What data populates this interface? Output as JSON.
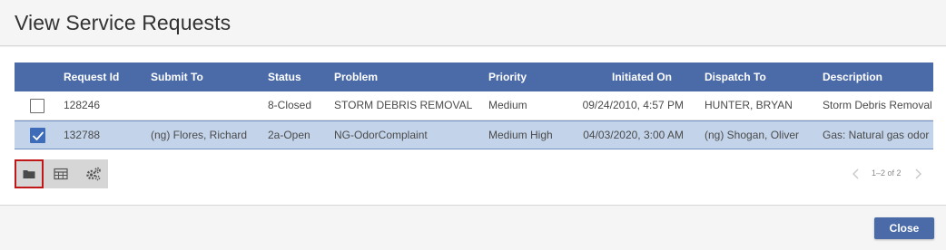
{
  "dialog": {
    "title": "View Service Requests"
  },
  "table": {
    "columns": {
      "request_id": "Request Id",
      "submit_to": "Submit To",
      "status": "Status",
      "problem": "Problem",
      "priority": "Priority",
      "initiated_on": "Initiated On",
      "dispatch_to": "Dispatch To",
      "description": "Description"
    },
    "rows": [
      {
        "checked": false,
        "request_id": "128246",
        "submit_to": "",
        "status": "8-Closed",
        "problem": "STORM DEBRIS REMOVAL",
        "priority": "Medium",
        "initiated_on": "09/24/2010, 4:57 PM",
        "dispatch_to": "HUNTER, BRYAN",
        "description": "Storm Debris Removal"
      },
      {
        "checked": true,
        "request_id": "132788",
        "submit_to": "(ng) Flores, Richard",
        "status": "2a-Open",
        "problem": "NG-OdorComplaint",
        "priority": "Medium High",
        "initiated_on": "04/03/2020, 3:00 AM",
        "dispatch_to": "(ng) Shogan, Oliver",
        "description": "Gas: Natural gas odor"
      }
    ]
  },
  "toolbar": {
    "icons": [
      "folder-icon",
      "table-icon",
      "gears-icon"
    ]
  },
  "pager": {
    "range_text": "1–2 of 2"
  },
  "footer": {
    "close_label": "Close"
  },
  "colors": {
    "header_blue": "#4a6aa8",
    "selected_row": "#c3d4ea",
    "active_border": "#c01818"
  }
}
